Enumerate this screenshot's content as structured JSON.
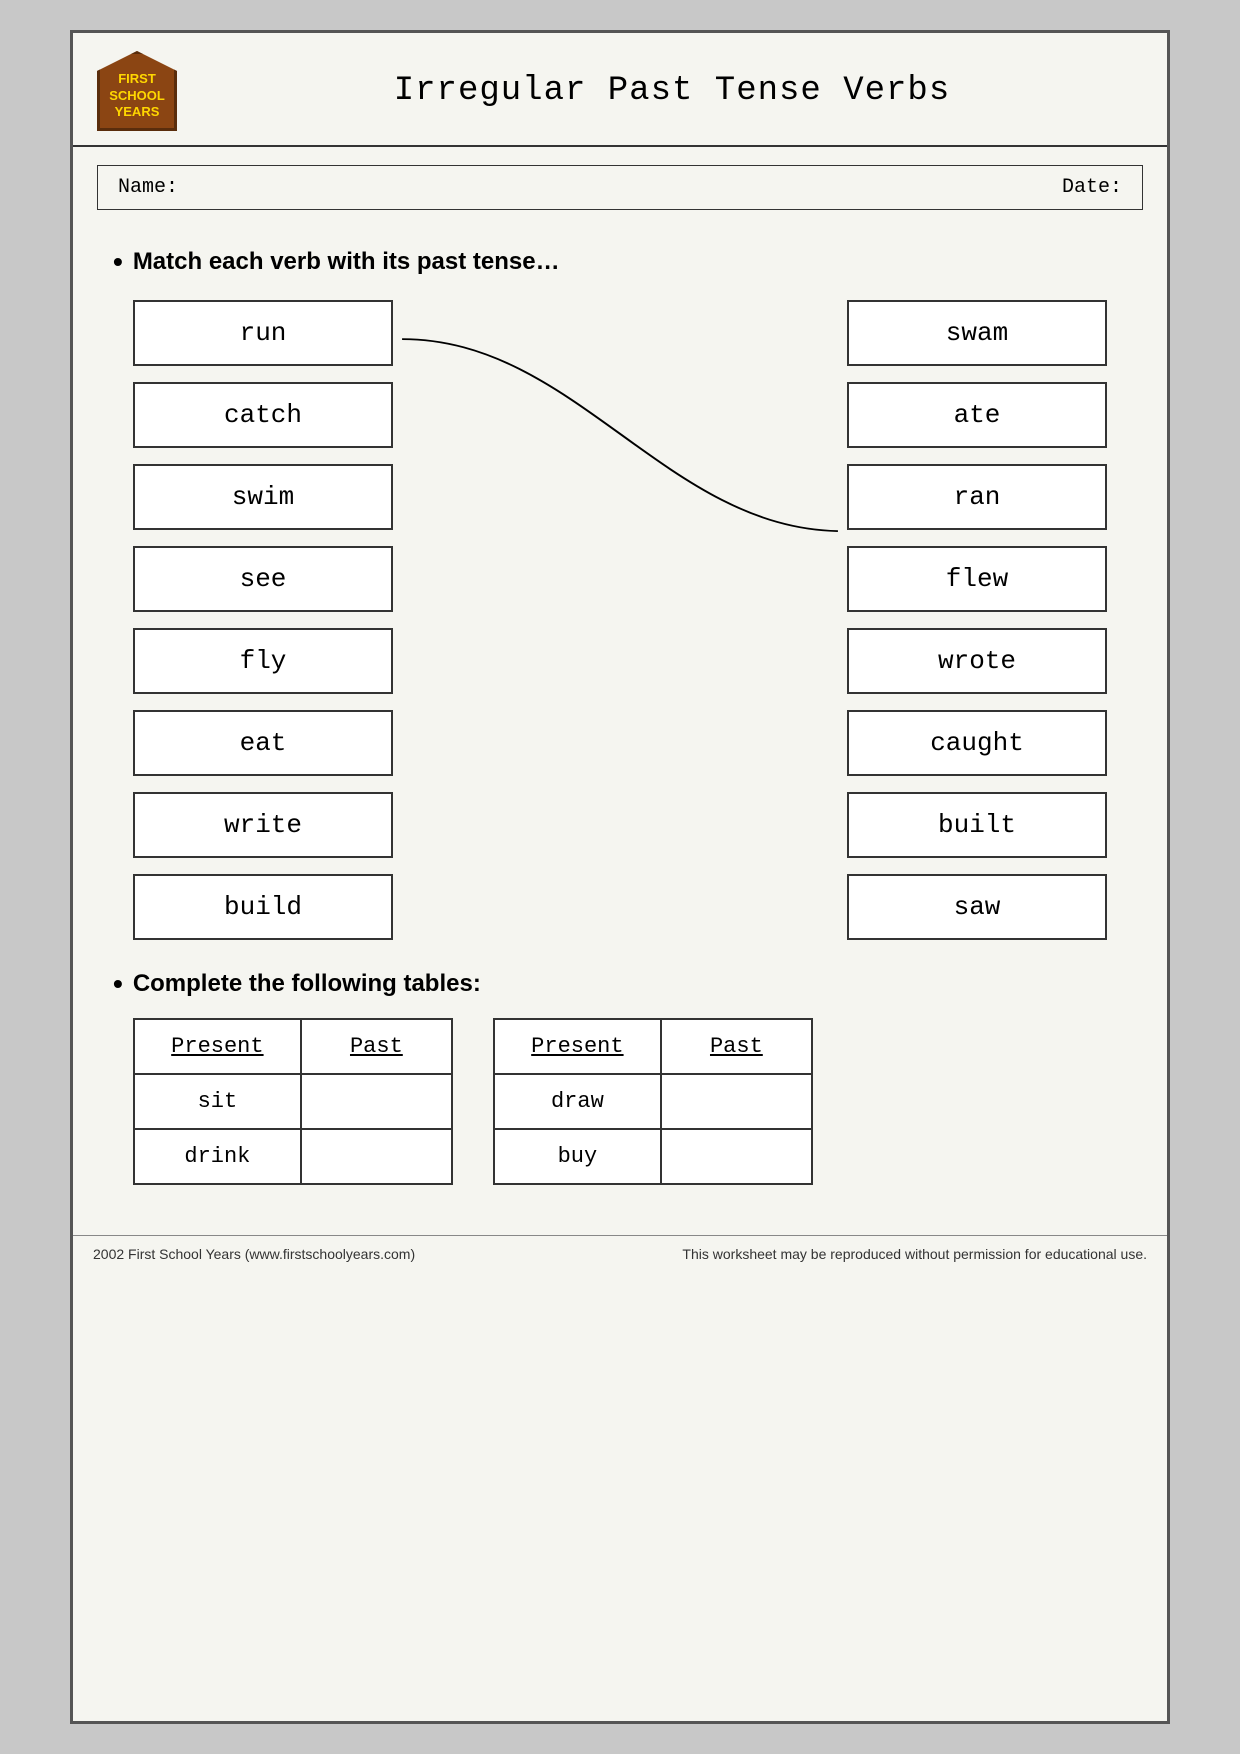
{
  "header": {
    "logo": {
      "line1": "FIRST",
      "line2": "SCHOOL",
      "line3": "YEARS"
    },
    "title": "Irregular Past Tense Verbs"
  },
  "nameDate": {
    "nameLabel": "Name:",
    "dateLabel": "Date:"
  },
  "instruction1": "Match each verb with its past tense…",
  "leftColumn": [
    "run",
    "catch",
    "swim",
    "see",
    "fly",
    "eat",
    "write",
    "build"
  ],
  "rightColumn": [
    "swam",
    "ate",
    "ran",
    "flew",
    "wrote",
    "caught",
    "built",
    "saw"
  ],
  "instruction2": "Complete the following tables:",
  "table1": {
    "headers": [
      "Present",
      "Past"
    ],
    "rows": [
      [
        "sit",
        ""
      ],
      [
        "drink",
        ""
      ]
    ]
  },
  "table2": {
    "headers": [
      "Present",
      "Past"
    ],
    "rows": [
      [
        "draw",
        ""
      ],
      [
        "buy",
        ""
      ]
    ]
  },
  "footer": {
    "left": "2002 First School Years  (www.firstschoolyears.com)",
    "right": "This worksheet may be reproduced without permission for educational use."
  }
}
